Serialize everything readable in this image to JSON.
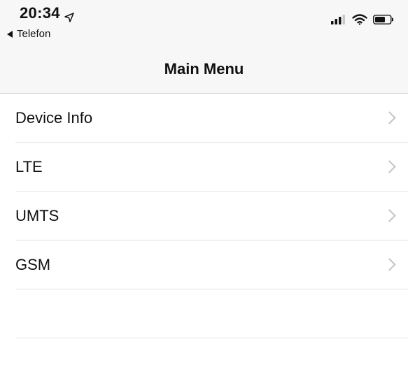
{
  "status_bar": {
    "time": "20:34",
    "location_icon": "location-arrow-icon",
    "back_label": "Telefon",
    "signal_icon": "cellular-signal-icon",
    "wifi_icon": "wifi-icon",
    "battery_icon": "battery-icon"
  },
  "nav": {
    "title": "Main Menu"
  },
  "menu": {
    "items": [
      {
        "label": "Device Info",
        "icon": "chevron-right-icon"
      },
      {
        "label": "LTE",
        "icon": "chevron-right-icon"
      },
      {
        "label": "UMTS",
        "icon": "chevron-right-icon"
      },
      {
        "label": "GSM",
        "icon": "chevron-right-icon"
      }
    ]
  },
  "colors": {
    "bar_background": "#f7f7f7",
    "separator": "#e2e2e2",
    "chevron": "#c4c4c4",
    "text": "#111111"
  }
}
